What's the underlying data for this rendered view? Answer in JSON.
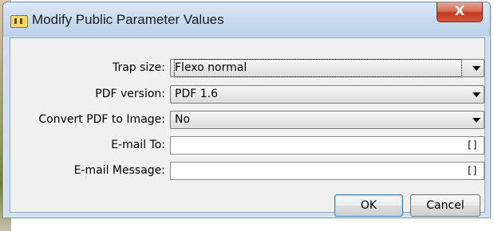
{
  "window": {
    "title": "Modify Public Parameter Values",
    "close_label": "X"
  },
  "form": {
    "rows": [
      {
        "label": "Trap size:",
        "value": "Flexo normal",
        "type": "select"
      },
      {
        "label": "PDF version:",
        "value": "PDF 1.6",
        "type": "select"
      },
      {
        "label": "Convert PDF to Image:",
        "value": "No",
        "type": "select"
      },
      {
        "label": "E-mail To:",
        "value": "",
        "type": "text",
        "icon": "[]"
      },
      {
        "label": "E-mail Message:",
        "value": "",
        "type": "text",
        "icon": "[]"
      }
    ]
  },
  "buttons": {
    "ok": "OK",
    "cancel": "Cancel"
  }
}
